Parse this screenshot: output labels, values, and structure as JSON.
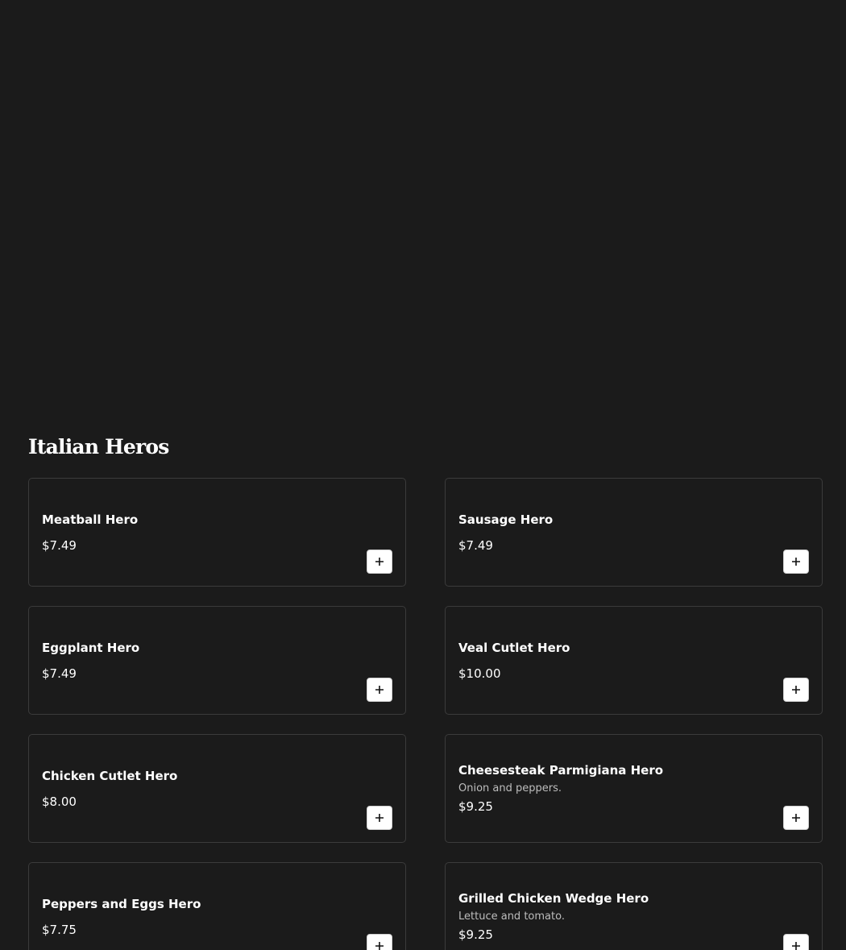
{
  "section": {
    "title": "Italian Heros"
  },
  "icons": {
    "add": "plus-icon"
  },
  "colors": {
    "background": "#1b1b1b",
    "card_border": "#3b3b3b",
    "text": "#ffffff",
    "muted_text": "#bdbdbd"
  },
  "items": [
    {
      "name": "Meatball Hero",
      "description": "",
      "price": "$7.49"
    },
    {
      "name": "Sausage Hero",
      "description": "",
      "price": "$7.49"
    },
    {
      "name": "Eggplant Hero",
      "description": "",
      "price": "$7.49"
    },
    {
      "name": "Veal Cutlet Hero",
      "description": "",
      "price": "$10.00"
    },
    {
      "name": "Chicken Cutlet Hero",
      "description": "",
      "price": "$8.00"
    },
    {
      "name": "Cheesesteak Parmigiana Hero",
      "description": "Onion and peppers.",
      "price": "$9.25"
    },
    {
      "name": "Peppers and Eggs Hero",
      "description": "",
      "price": "$7.75"
    },
    {
      "name": "Grilled Chicken Wedge Hero",
      "description": "Lettuce and tomato.",
      "price": "$9.25"
    }
  ]
}
